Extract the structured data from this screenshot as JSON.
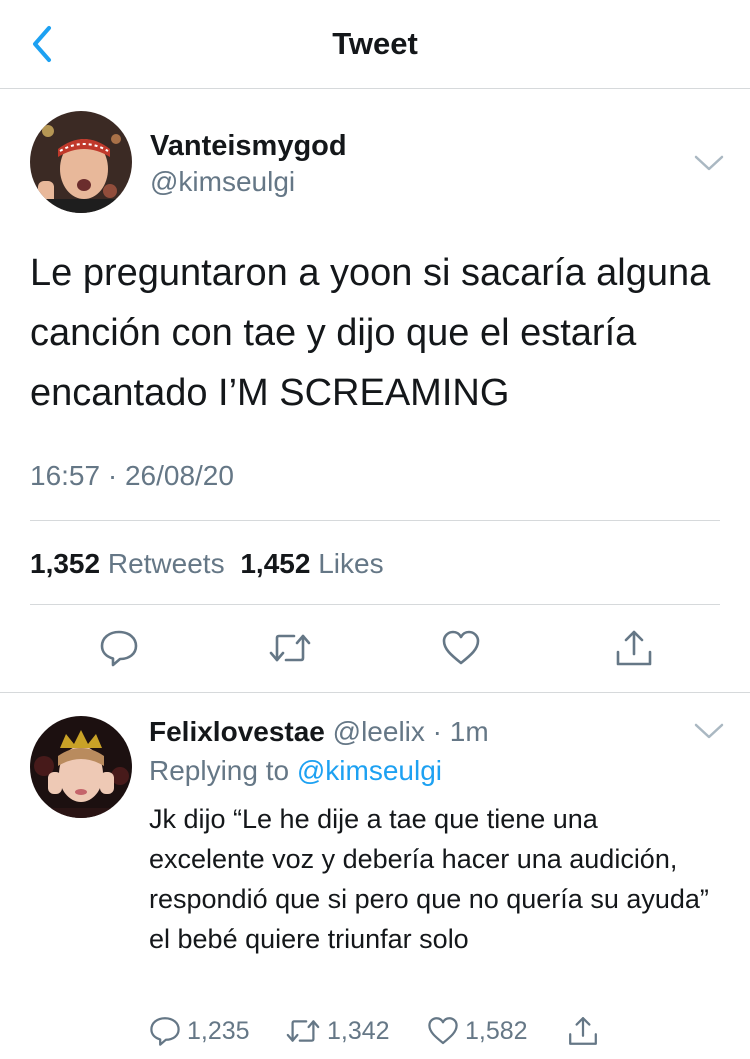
{
  "header": {
    "title": "Tweet"
  },
  "tweet": {
    "author_name": "Vanteismygod",
    "author_handle": "@kimseulgi",
    "text": "Le preguntaron a yoon si sacaría alguna canción con tae y dijo que el estaría encantado I’M SCREAMING",
    "timestamp": "16:57 · 26/08/20",
    "retweets_count": "1,352",
    "retweets_label": "Retweets",
    "likes_count": "1,452",
    "likes_label": "Likes"
  },
  "reply": {
    "author_name": "Felixlovestae",
    "author_handle": "@leelix",
    "time": "· 1m",
    "replying_prefix": "Replying to",
    "replying_to": "@kimseulgi",
    "text": "Jk dijo “Le he dije a tae que tiene una excelente voz y debería hacer una audición, respondió que si pero que no quería su ayuda” el bebé quiere triunfar solo",
    "reply_count": "1,235",
    "retweet_count": "1,342",
    "like_count": "1,582"
  },
  "colors": {
    "accent": "#1da1f2",
    "secondary_text": "#657786",
    "divider": "#d6d9db"
  },
  "icons": [
    "back-chevron",
    "chevron-down",
    "reply",
    "retweet",
    "like",
    "share"
  ]
}
